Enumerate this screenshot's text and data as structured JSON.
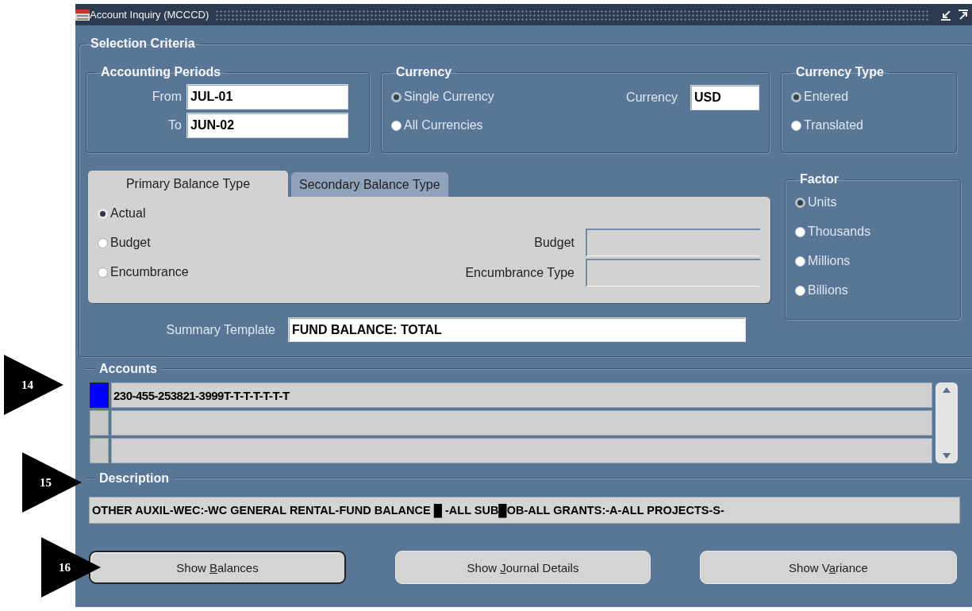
{
  "window": {
    "title": "Account Inquiry (MCCCD)"
  },
  "selection_criteria": {
    "title": "Selection Criteria",
    "accounting_periods": {
      "title": "Accounting Periods",
      "fields": [
        {
          "label": "From",
          "value": "JUL-01"
        },
        {
          "label": "To",
          "value": "JUN-02"
        }
      ]
    },
    "currency": {
      "title": "Currency",
      "options": [
        {
          "label": "Single Currency",
          "selected": true
        },
        {
          "label": "All Currencies",
          "selected": false
        }
      ],
      "field": {
        "label": "Currency",
        "value": "USD"
      }
    },
    "currency_type": {
      "title": "Currency Type",
      "options": [
        {
          "label": "Entered",
          "selected": true
        },
        {
          "label": "Translated",
          "selected": false
        }
      ]
    },
    "balance_tabs": [
      {
        "label": "Primary Balance Type",
        "selected": true
      },
      {
        "label": "Secondary Balance Type",
        "selected": false
      }
    ],
    "balance_options": [
      {
        "label": "Actual",
        "selected": true
      },
      {
        "label": "Budget",
        "selected": false
      },
      {
        "label": "Encumbrance",
        "selected": false
      }
    ],
    "balance_fields": [
      {
        "label": "Budget"
      },
      {
        "label": "Encumbrance Type"
      }
    ],
    "factor": {
      "title": "Factor",
      "options": [
        {
          "label": "Units",
          "selected": true
        },
        {
          "label": "Thousands",
          "selected": false
        },
        {
          "label": "Millions",
          "selected": false
        },
        {
          "label": "Billions",
          "selected": false
        }
      ]
    },
    "summary_template": {
      "label": "Summary Template",
      "value": "FUND BALANCE: TOTAL"
    }
  },
  "accounts": {
    "title": "Accounts",
    "rows": [
      {
        "value": "230-455-253821-3999T-T-T-T-T-T-T",
        "selected": true
      },
      {
        "selected": false
      },
      {
        "selected": false
      }
    ]
  },
  "description": {
    "title": "Description",
    "value": "OTHER AUXIL-WEC:-WC GENERAL RENTAL-FUND BALANCE █ -ALL SUB█OB-ALL GRANTS:-A-ALL PROJECTS-S-"
  },
  "buttons": [
    {
      "before": "Show ",
      "mnemonic": "B",
      "after": "alances",
      "focused": true
    },
    {
      "before": "Show ",
      "mnemonic": "J",
      "after": "ournal Details",
      "focused": false
    },
    {
      "before": "Show V",
      "mnemonic": "a",
      "after": "riance",
      "focused": false
    }
  ],
  "callouts": [
    "14",
    "15",
    "16"
  ]
}
